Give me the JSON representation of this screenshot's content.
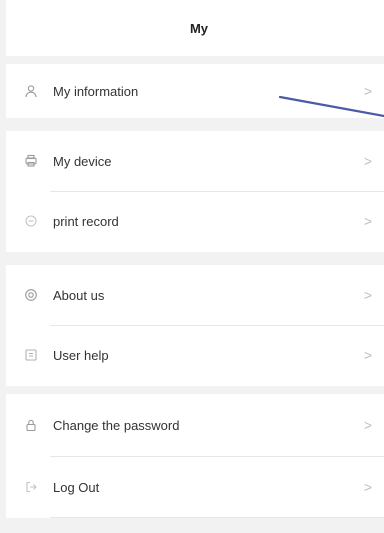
{
  "header": {
    "title": "My"
  },
  "menu": {
    "groups": [
      {
        "items": [
          {
            "label": "My information",
            "icon": "person-icon",
            "chevron": ">"
          }
        ]
      },
      {
        "items": [
          {
            "label": "My device",
            "icon": "printer-icon",
            "chevron": ">"
          },
          {
            "label": "print record",
            "icon": "record-icon",
            "chevron": ">"
          }
        ]
      },
      {
        "items": [
          {
            "label": "About us",
            "icon": "info-icon",
            "chevron": ">"
          },
          {
            "label": "User help",
            "icon": "help-book-icon",
            "chevron": ">"
          }
        ]
      },
      {
        "items": [
          {
            "label": "Change the password",
            "icon": "lock-icon",
            "chevron": ">"
          },
          {
            "label": "Log Out",
            "icon": "logout-icon",
            "chevron": ">"
          }
        ]
      }
    ]
  },
  "colors": {
    "background": "#f2f2f2",
    "card": "#ffffff",
    "annotation_line": "#4a5aa8"
  }
}
